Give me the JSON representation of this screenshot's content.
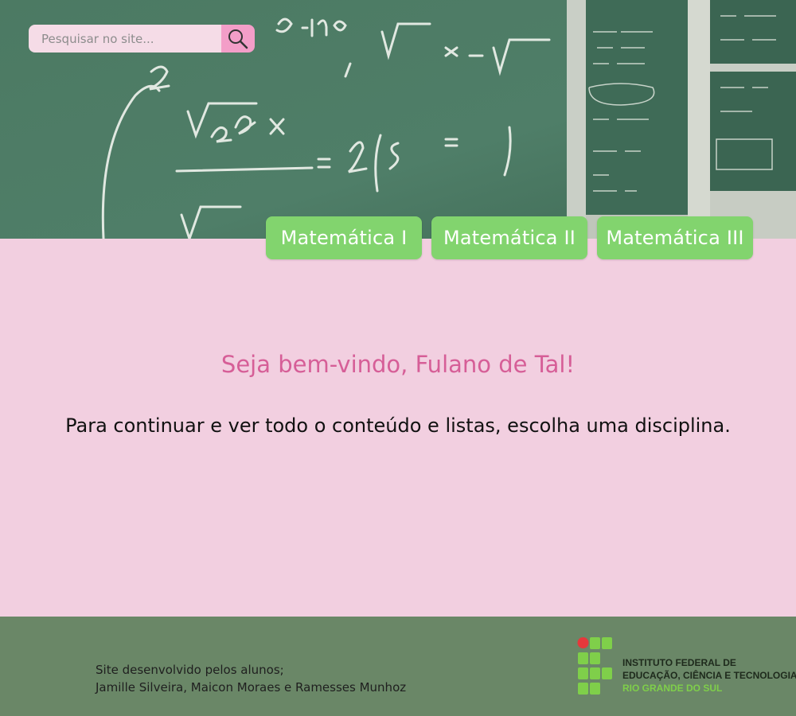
{
  "search": {
    "placeholder": "Pesquisar no site..."
  },
  "tabs": [
    {
      "label": "Matemática I"
    },
    {
      "label": "Matemática II"
    },
    {
      "label": "Matemática III"
    }
  ],
  "main": {
    "welcome": "Seja bem-vindo, Fulano de Tal!",
    "instruction": "Para continuar e ver todo o conteúdo e listas, escolha uma disciplina."
  },
  "footer": {
    "credits_line1": "Site desenvolvido pelos alunos;",
    "credits_line2": "Jamille Silveira, Maicon Moraes e Ramesses Munhoz",
    "logo_line1": "INSTITUTO FEDERAL DE",
    "logo_line2": "EDUCAÇÃO, CIÊNCIA E TECNOLOGIA",
    "logo_line3": "RIO GRANDE DO SUL"
  },
  "colors": {
    "page_bg": "#f2cfe0",
    "tab_bg": "#82d46e",
    "welcome_text": "#d65e97",
    "footer_bg": "#6a8767",
    "search_button": "#f39ec8",
    "logo_red": "#e5383b",
    "logo_green": "#7fcf4a"
  },
  "icons": {
    "search": "search-icon",
    "logo": "institute-logo"
  }
}
